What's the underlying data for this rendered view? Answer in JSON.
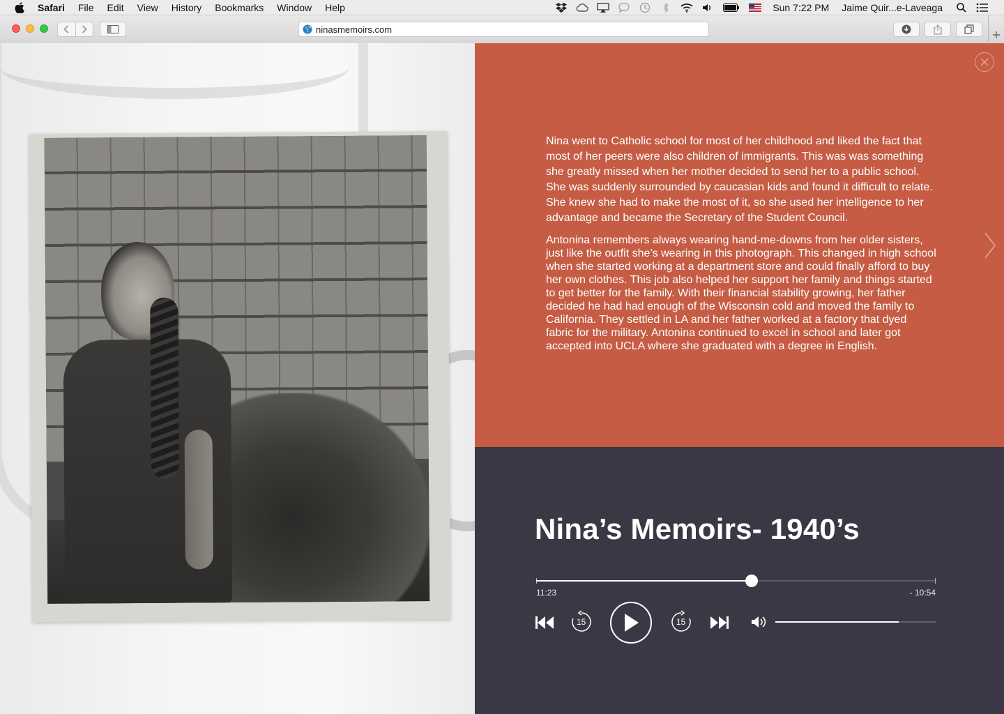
{
  "menubar": {
    "app_name": "Safari",
    "items": [
      "File",
      "Edit",
      "View",
      "History",
      "Bookmarks",
      "Window",
      "Help"
    ],
    "clock": "Sun 7:22 PM",
    "user": "Jaime Quir...e-Laveaga"
  },
  "browser": {
    "url": "ninasmemoirs.com"
  },
  "story": {
    "paragraph_1": "Nina went to Catholic school for most of her childhood and liked the fact that most of her peers were also children of immigrants. This was was something she greatly missed when her mother decided to send her to a public school. She was suddenly surrounded by caucasian kids and found it difficult to relate. She knew she had to make the most of it, so she used her intelligence to her advantage and became the Secretary of the Student Council.",
    "paragraph_2": "Antonina remembers always wearing hand-me-downs from her older sisters, just like the outfit she’s wearing in this photograph. This changed in high school when she started working at a department store and could finally afford to buy her own clothes. This job also helped her support her family and things started to get better for the family. With their financial stability growing, her father decided he had had enough of the Wisconsin cold and moved the family to California. They settled in LA and her father worked at a factory that dyed fabric for the military. Antonina continued to excel in school and later got accepted into UCLA where she graduated with a degree in English."
  },
  "player": {
    "title": "Nina’s Memoirs- 1940’s",
    "elapsed": "11:23",
    "remaining": "- 10:54",
    "progress_fraction": 0.54,
    "volume_fraction": 0.77,
    "skip_back_seconds": "15",
    "skip_forward_seconds": "15"
  },
  "colors": {
    "story_bg": "#c65c44",
    "player_bg": "#3a3845"
  }
}
